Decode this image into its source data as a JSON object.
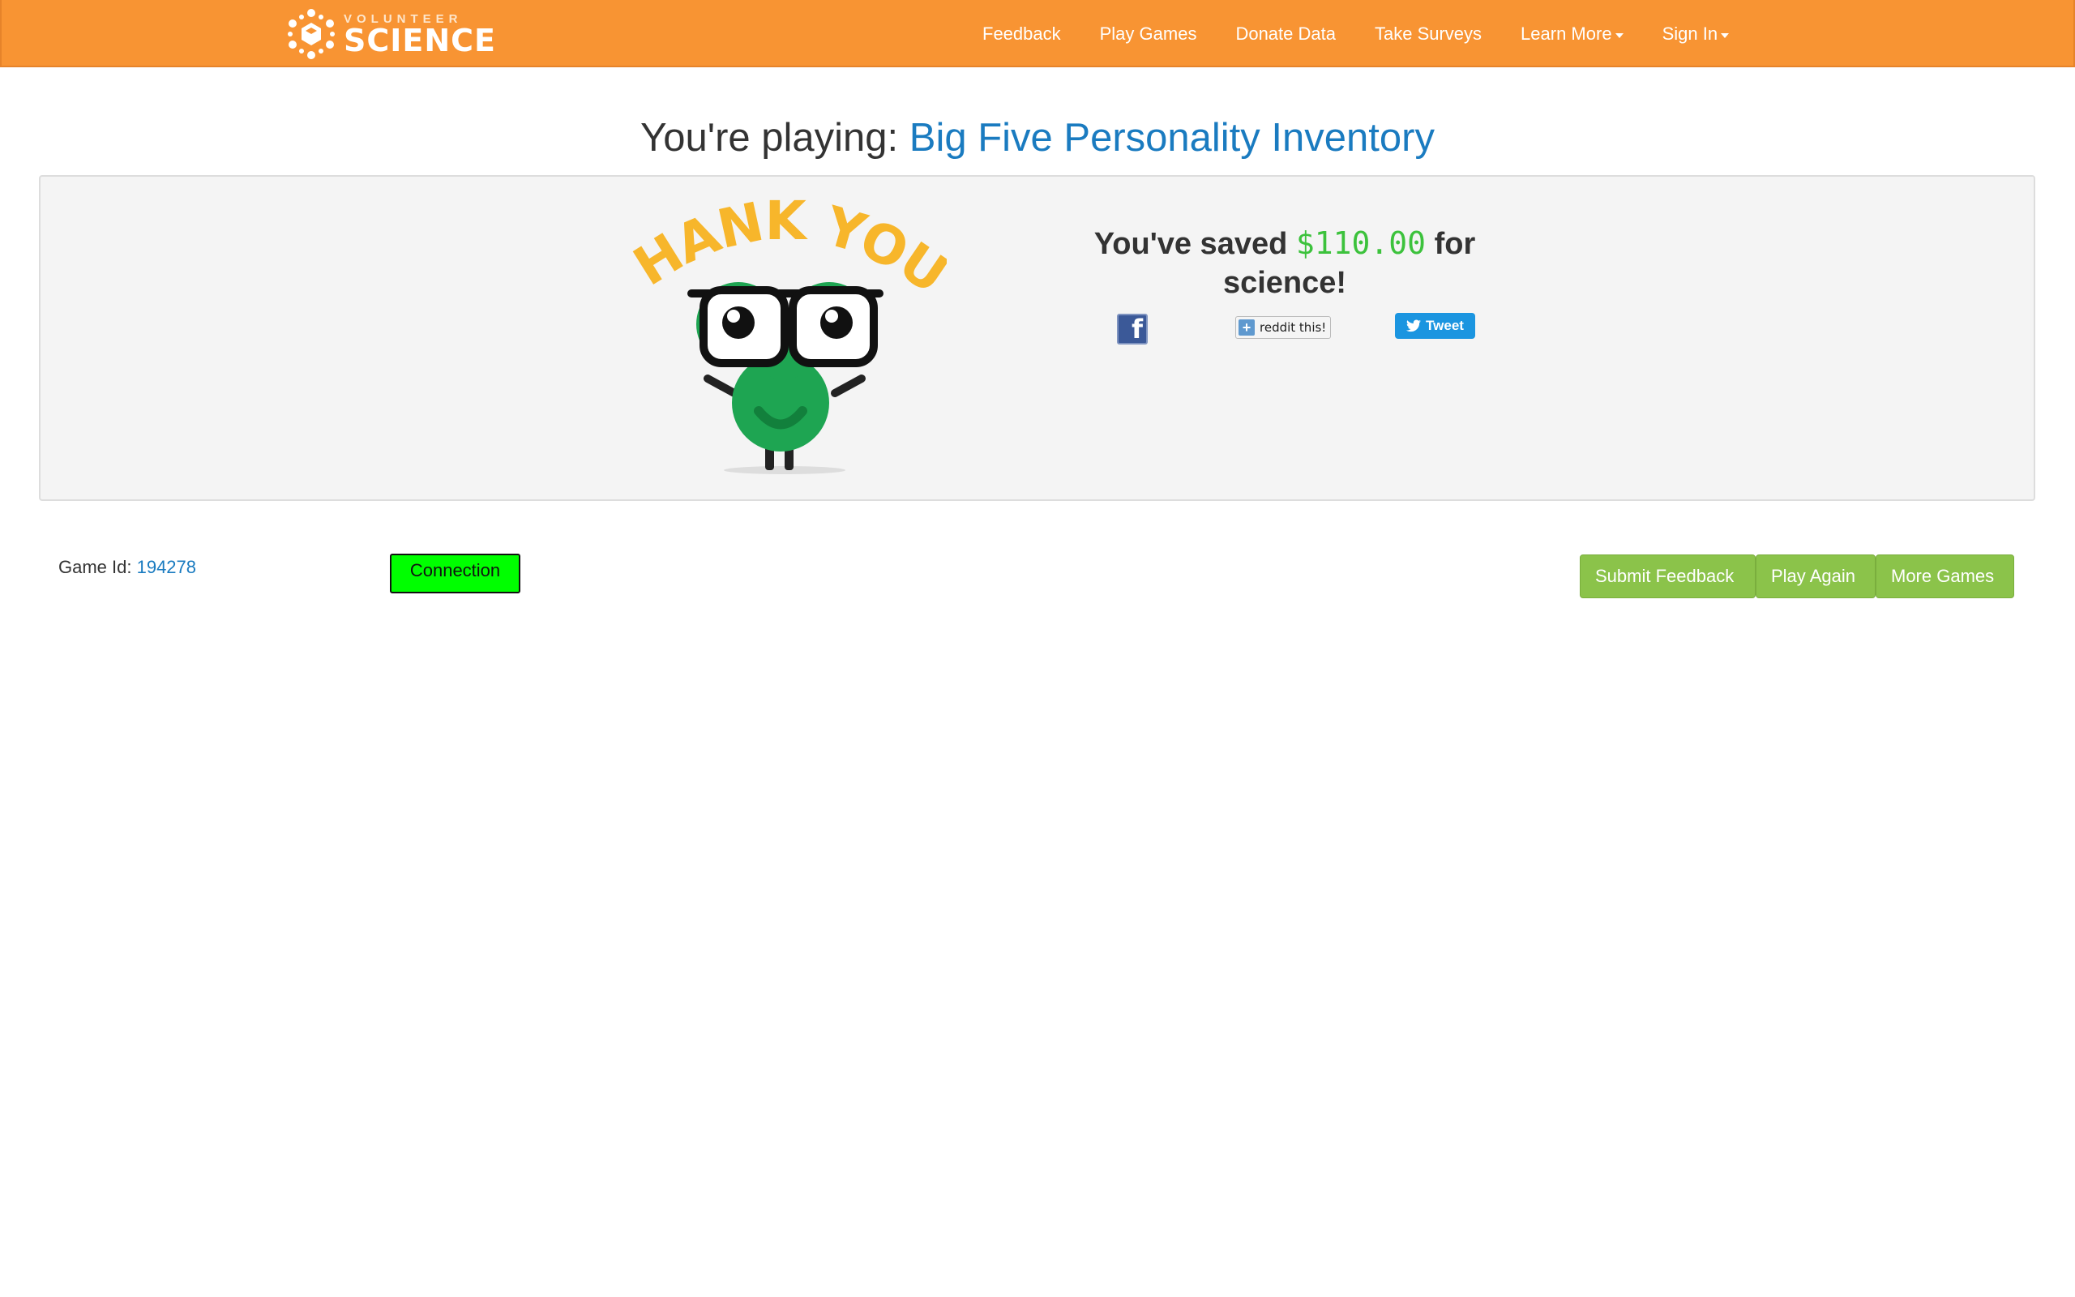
{
  "nav": {
    "brand_small": "VOLUNTEER",
    "brand_big": "SCIENCE",
    "items": [
      {
        "label": "Feedback"
      },
      {
        "label": "Play Games"
      },
      {
        "label": "Donate Data"
      },
      {
        "label": "Take Surveys"
      },
      {
        "label": "Learn More"
      },
      {
        "label": "Sign In"
      }
    ]
  },
  "header": {
    "prefix": "You're playing: ",
    "game_name": "Big Five Personality Inventory"
  },
  "thanks": {
    "banner": "THANK YOU!",
    "saved_prefix": "You've saved ",
    "amount": "$110.00",
    "saved_suffix": " for science!"
  },
  "share": {
    "facebook": "f",
    "reddit": "reddit this!",
    "tweet": "Tweet"
  },
  "footer": {
    "game_id_label": "Game Id: ",
    "game_id_value": "194278",
    "connection": "Connection",
    "buttons": [
      {
        "label": "Submit Feedback"
      },
      {
        "label": "Play Again"
      },
      {
        "label": "More Games"
      }
    ]
  },
  "colors": {
    "nav_bg": "#f89433",
    "link": "#1a7bc0",
    "amount": "#3cc23c",
    "button": "#8bc34a",
    "connection": "#00ff00",
    "mascot": "#1ea552",
    "banner": "#f7b62b"
  }
}
